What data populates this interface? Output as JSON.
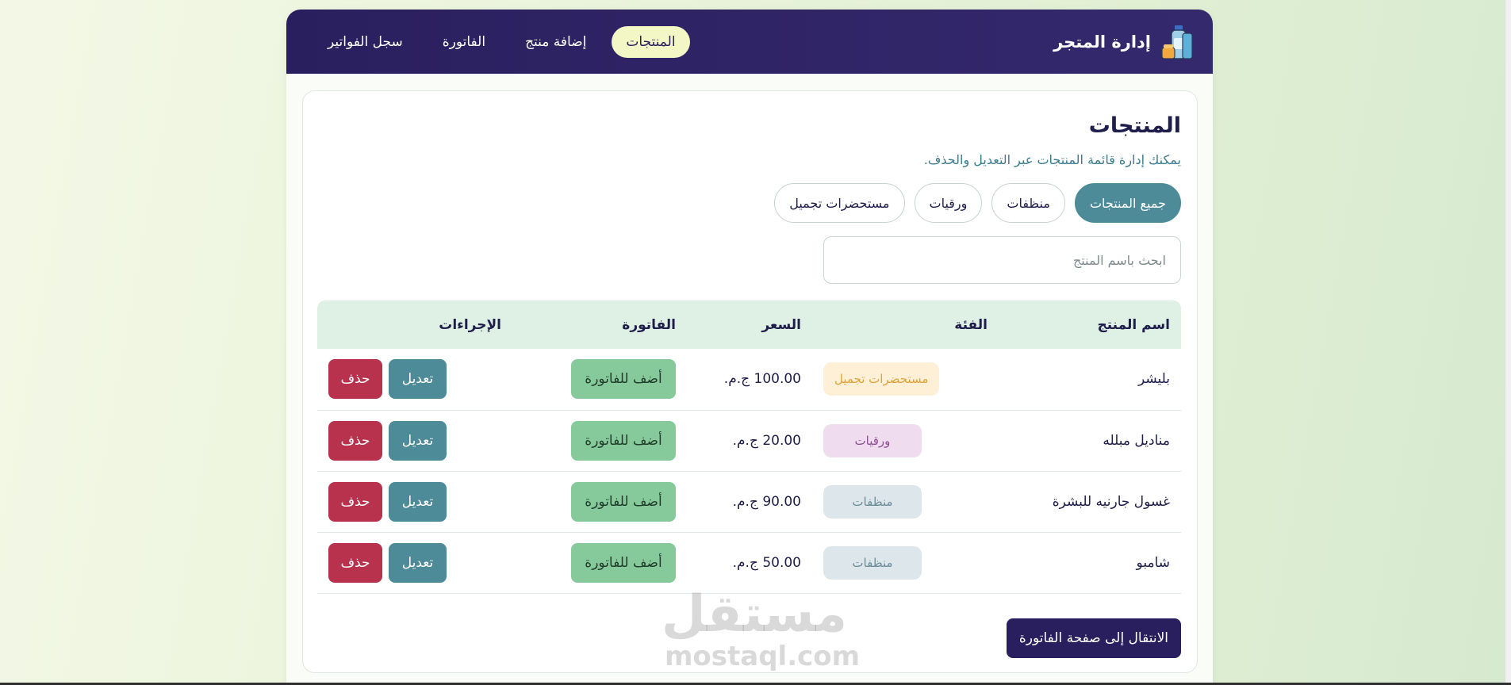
{
  "nav": {
    "brand": "إدارة المتجر",
    "links": [
      {
        "label": "المنتجات",
        "active": true
      },
      {
        "label": "إضافة منتج",
        "active": false
      },
      {
        "label": "الفاتورة",
        "active": false
      },
      {
        "label": "سجل الفواتير",
        "active": false
      }
    ]
  },
  "main": {
    "title": "المنتجات",
    "subtitle": "يمكنك إدارة قائمة المنتجات عبر التعديل والحذف.",
    "filters": [
      {
        "label": "جميع المنتجات",
        "active": true
      },
      {
        "label": "منظفات",
        "active": false
      },
      {
        "label": "ورقيات",
        "active": false
      },
      {
        "label": "مستحضرات تجميل",
        "active": false
      }
    ],
    "search_placeholder": "ابحث باسم المنتج",
    "search_value": "",
    "table": {
      "headers": [
        "اسم المنتج",
        "الفئة",
        "السعر",
        "الفاتورة",
        "الإجراءات"
      ],
      "rows": [
        {
          "name": "بليشر",
          "category": "مستحضرات تجميل",
          "category_style": "cosmetics",
          "price": "100.00 ج.م."
        },
        {
          "name": "مناديل مبلله",
          "category": "ورقيات",
          "category_style": "paper",
          "price": "20.00 ج.م."
        },
        {
          "name": "غسول جارنيه للبشرة",
          "category": "منظفات",
          "category_style": "clean",
          "price": "90.00 ج.م."
        },
        {
          "name": "شامبو",
          "category": "منظفات",
          "category_style": "clean",
          "price": "50.00 ج.م."
        }
      ],
      "add_to_invoice_label": "أضف للفاتورة",
      "edit_label": "تعديل",
      "delete_label": "حذف"
    },
    "goto_invoice_label": "الانتقال إلى صفحة الفاتورة"
  },
  "watermark": {
    "arabic": "مستقل",
    "latin": "mostaql.com"
  },
  "colors": {
    "nav_bg": "#2a1f5e",
    "nav_active_bg": "#f3f7c5",
    "teal": "#4d8b98",
    "green_button": "#86c99a",
    "delete_red": "#b9324d",
    "table_header_bg": "#dff0e4"
  }
}
